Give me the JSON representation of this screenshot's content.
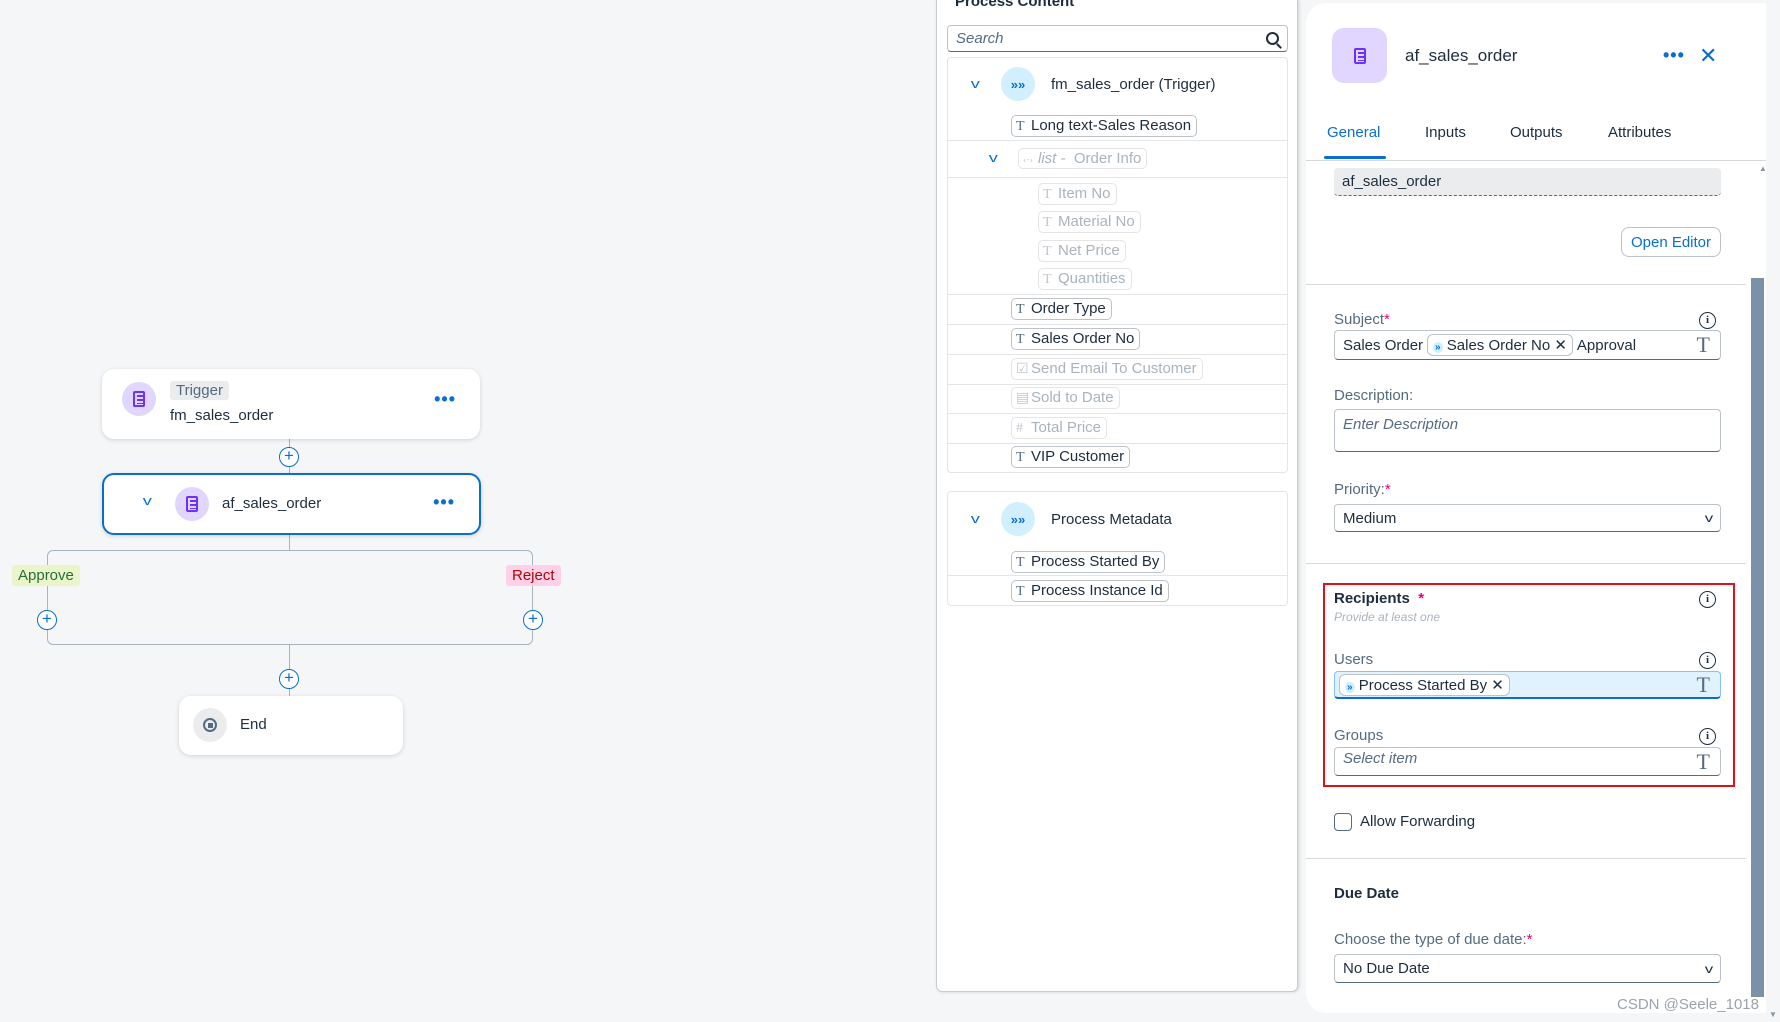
{
  "flow": {
    "trigger": {
      "tag": "Trigger",
      "name": "fm_sales_order"
    },
    "approval": {
      "name": "af_sales_order"
    },
    "branches": {
      "approve": "Approve",
      "reject": "Reject"
    },
    "end": {
      "name": "End"
    }
  },
  "process_content": {
    "title": "Process Content",
    "search_placeholder": "Search",
    "trigger_group": {
      "label": "fm_sales_order (Trigger)"
    },
    "items": {
      "long_text": "Long text-Sales Reason",
      "list_prefix": "list -",
      "list_label": "Order Info",
      "item_no": "Item No",
      "material_no": "Material No",
      "net_price": "Net Price",
      "quantities": "Quantities",
      "order_type": "Order Type",
      "sales_order_no": "Sales Order No",
      "send_email": "Send Email To Customer",
      "sold_to_date": "Sold to Date",
      "total_price": "Total Price",
      "vip_customer": "VIP Customer"
    },
    "metadata_group": {
      "label": "Process Metadata",
      "items": [
        "Process Started By",
        "Process Instance Id"
      ]
    }
  },
  "details": {
    "title": "af_sales_order",
    "tabs": [
      "General",
      "Inputs",
      "Outputs",
      "Attributes"
    ],
    "active_tab": "General",
    "approval_form_value": "af_sales_order",
    "open_editor": "Open Editor",
    "subject": {
      "label": "Subject",
      "parts": [
        "Sales Order",
        "Sales Order No",
        "Approval"
      ]
    },
    "description": {
      "label": "Description:",
      "placeholder": "Enter Description"
    },
    "priority": {
      "label": "Priority:",
      "value": "Medium"
    },
    "recipients": {
      "label": "Recipients",
      "hint": "Provide at least one",
      "users_label": "Users",
      "users_token": "Process Started By",
      "groups_label": "Groups",
      "groups_placeholder": "Select item"
    },
    "allow_forwarding": {
      "label": "Allow Forwarding",
      "checked": false
    },
    "due_date": {
      "heading": "Due Date",
      "label": "Choose the type of due date:",
      "value": "No Due Date"
    }
  },
  "watermark": "CSDN @Seele_1018",
  "colors": {
    "accent": "#0a6ed1",
    "highlight_box": "#e3101c",
    "node_icon_bg": "#e0d6ff",
    "approve_bg": "#ebf5cb",
    "reject_bg": "#ffd0e7"
  }
}
